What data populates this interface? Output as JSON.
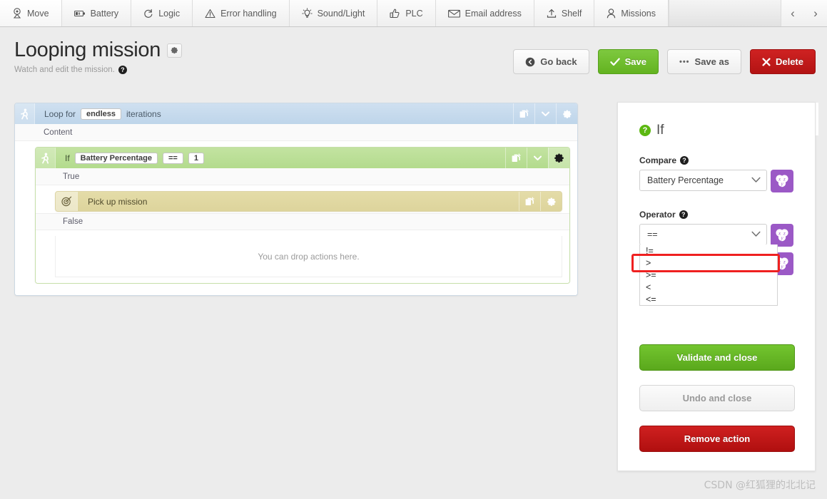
{
  "toolbar": {
    "items": [
      {
        "label": "Move",
        "icon": "move-pin-icon"
      },
      {
        "label": "Battery",
        "icon": "battery-icon"
      },
      {
        "label": "Logic",
        "icon": "logic-loop-icon"
      },
      {
        "label": "Error handling",
        "icon": "warning-triangle-icon"
      },
      {
        "label": "Sound/Light",
        "icon": "lightbulb-icon"
      },
      {
        "label": "PLC",
        "icon": "thumbs-up-icon"
      },
      {
        "label": "Email address",
        "icon": "envelope-icon"
      },
      {
        "label": "Shelf",
        "icon": "upload-shelf-icon"
      },
      {
        "label": "Missions",
        "icon": "user-icon"
      }
    ],
    "prev_label": "‹",
    "next_label": "›"
  },
  "header": {
    "title": "Looping mission",
    "subtitle": "Watch and edit the mission.",
    "help_badge": "?",
    "settings_gear": "⚙",
    "buttons": {
      "go_back": "Go back",
      "save": "Save",
      "save_as": "Save as",
      "save_as_dots": "•••",
      "delete": "Delete"
    }
  },
  "editor": {
    "loop": {
      "title_prefix": "Loop for",
      "iterations_value": "endless",
      "title_suffix": "iterations",
      "content_label": "Content",
      "tools": {
        "duplicate": "duplicate-icon",
        "dropdown": "chevron-down-icon",
        "settings": "gear-icon"
      }
    },
    "if_block": {
      "keyword": "If",
      "variable": "Battery Percentage",
      "operator": "==",
      "value": "1",
      "true_label": "True",
      "false_label": "False",
      "drop_hint": "You can drop actions here.",
      "action": {
        "label": "Pick up mission",
        "icon": "target-icon"
      }
    }
  },
  "panel": {
    "title": "If",
    "help_badge": "?",
    "compare": {
      "label": "Compare",
      "value": "Battery Percentage",
      "help_badge": "?",
      "variable_button": "variable-picker-icon"
    },
    "operator": {
      "label": "Operator",
      "value": "==",
      "help_badge": "?",
      "variable_button": "variable-picker-icon",
      "options": [
        "!=",
        ">",
        ">=",
        "<",
        "<="
      ],
      "highlighted_option": ">"
    },
    "buttons": {
      "validate": "Validate and close",
      "undo": "Undo and close",
      "remove": "Remove action"
    }
  },
  "watermark": "CSDN @红狐狸的北北记",
  "colors": {
    "accent_green": "#63b320",
    "danger_red": "#b31313",
    "loop_blue": "#bed5ea",
    "if_green": "#b3db8d",
    "action_tan": "#ddd49c",
    "variable_purple": "#9b59c6",
    "highlight_red": "#ef2020"
  }
}
